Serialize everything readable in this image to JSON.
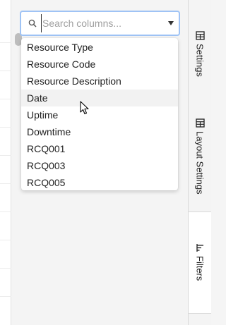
{
  "search": {
    "placeholder": "Search columns...",
    "value": ""
  },
  "columns": [
    "Resource Type",
    "Resource Code",
    "Resource Description",
    "Date",
    "Uptime",
    "Downtime",
    "RCQ001",
    "RCQ003",
    "RCQ005"
  ],
  "hovered_column": "Date",
  "side_tabs": [
    {
      "label": "Settings",
      "icon": "table-icon"
    },
    {
      "label": "Layout Settings",
      "icon": "table-icon"
    },
    {
      "label": "Filters",
      "icon": "filter-icon",
      "active": true
    }
  ],
  "colors": {
    "focus_border": "#9fc3f5",
    "hover_row": "#f2f2f2"
  }
}
